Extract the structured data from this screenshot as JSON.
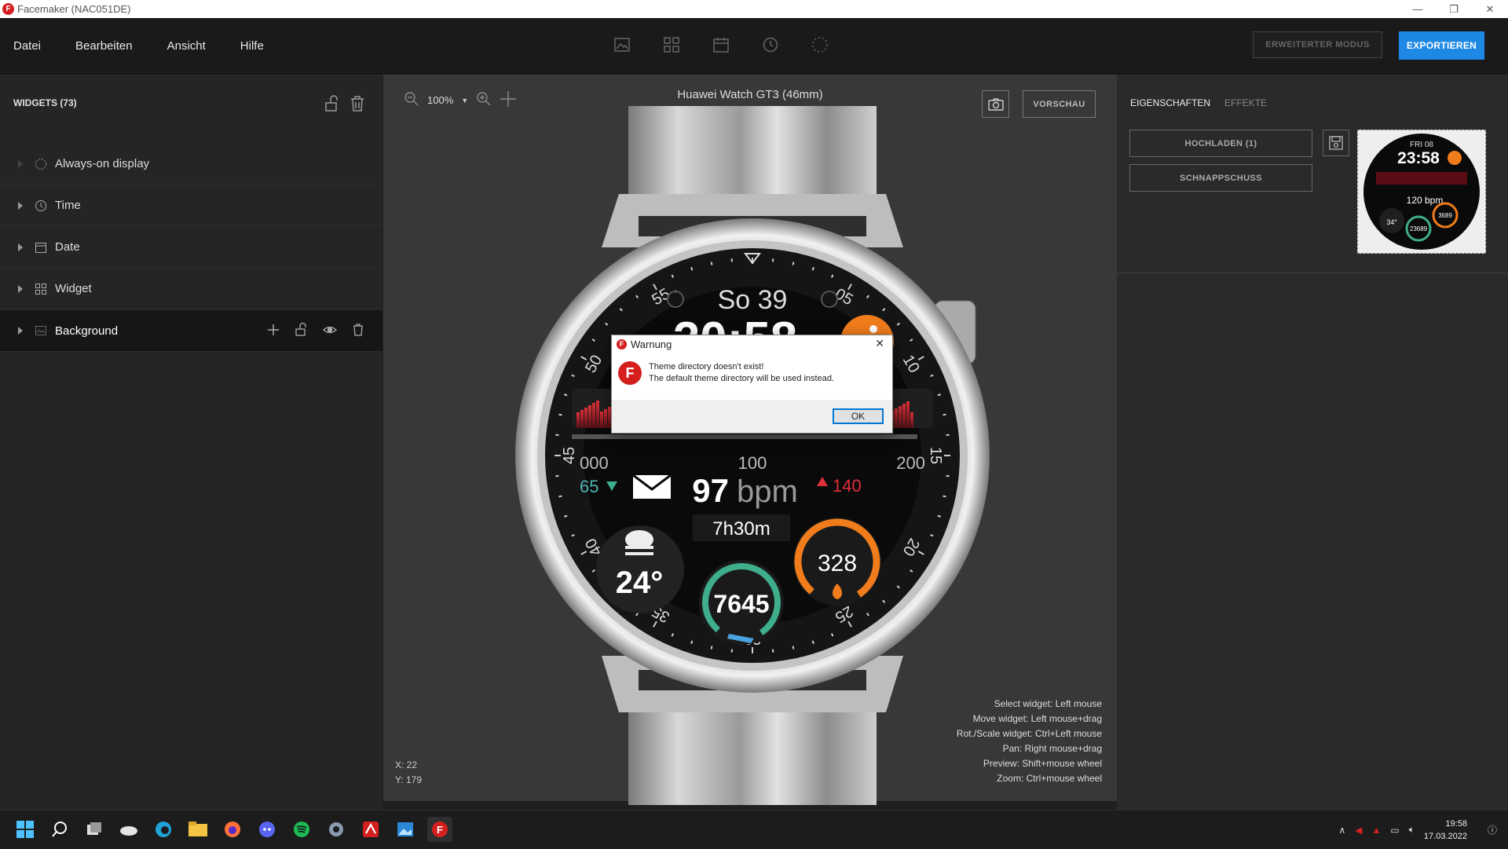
{
  "window": {
    "title": "Facemaker (NAC051DE)"
  },
  "menu": {
    "items": [
      "Datei",
      "Bearbeiten",
      "Ansicht",
      "Hilfe"
    ]
  },
  "toolbar": {
    "advanced_label": "ERWEITERTER MODUS",
    "export_label": "EXPORTIEREN"
  },
  "widgets": {
    "header": "WIDGETS  (73)",
    "items": [
      {
        "label": "Always-on display",
        "icon": "dotted-circle-icon"
      },
      {
        "label": "Time",
        "icon": "clock-icon"
      },
      {
        "label": "Date",
        "icon": "calendar-icon"
      },
      {
        "label": "Widget",
        "icon": "grid-icon"
      },
      {
        "label": "Background",
        "icon": "image-icon"
      }
    ]
  },
  "canvas": {
    "zoom": "100%",
    "device_name": "Huawei Watch GT3 (46mm)",
    "device_size": "46mm, 466x466",
    "preview_label": "VORSCHAU",
    "coords": {
      "x": "X: 22",
      "y": "Y: 179"
    },
    "help": [
      "Select widget: Left mouse",
      "Move widget: Left mouse+drag",
      "Rot./Scale widget: Ctrl+Left mouse",
      "Pan: Right mouse+drag",
      "Preview: Shift+mouse wheel",
      "Zoom: Ctrl+mouse wheel"
    ]
  },
  "watchface": {
    "day": "So 39",
    "time": "20:58",
    "scale_left": "000",
    "scale_mid": "100",
    "scale_right": "200",
    "hr_min": "65",
    "hr_value": "97",
    "hr_unit": "bpm",
    "hr_max": "140",
    "sleep": "7h30m",
    "temp": "24°",
    "steps": "7645",
    "calories": "328",
    "bezel": [
      "05",
      "10",
      "15",
      "20",
      "25",
      "30",
      "35",
      "40",
      "45",
      "50",
      "55"
    ],
    "colors": {
      "accent": "#f07c1b",
      "heart": "#c8102e",
      "steps": "#3fae8c",
      "min": "#4fb4b4"
    }
  },
  "properties": {
    "tab_active": "EIGENSCHAFTEN",
    "tab_other": "EFFEKTE",
    "upload_label": "HOCHLADEN (1)",
    "snapshot_label": "SCHNAPPSCHUSS",
    "thumb": {
      "date": "FRI 08",
      "time": "23:58",
      "bpm": "120 bpm",
      "temp": "34°",
      "steps": "23689",
      "cal": "3689"
    }
  },
  "dialog": {
    "title": "Warnung",
    "line1": "Theme directory doesn't exist!",
    "line2": "The default theme directory will be used instead.",
    "ok_label": "OK"
  },
  "taskbar": {
    "time": "19:58",
    "date": "17.03.2022"
  }
}
